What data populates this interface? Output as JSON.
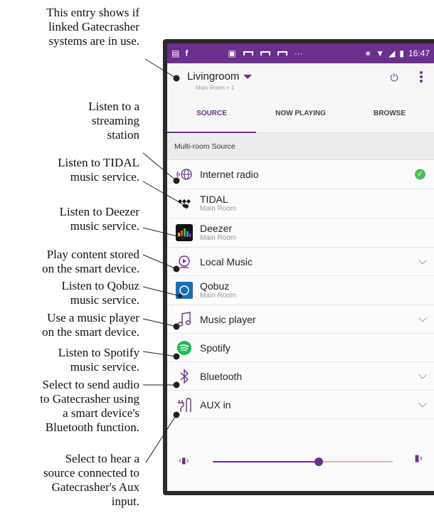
{
  "callouts": {
    "linked": [
      "This entry shows if",
      "linked Gatecrasher",
      "systems are in use."
    ],
    "streaming": [
      "Listen to a",
      "streaming",
      "station"
    ],
    "tidal": [
      "Listen to TIDAL",
      "music service."
    ],
    "deezer": [
      "Listen to Deezer",
      "music service."
    ],
    "local": [
      "Play content stored",
      "on the smart device."
    ],
    "qobuz": [
      "Listen to Qobuz",
      "music service."
    ],
    "player": [
      "Use a music player",
      "on the smart device."
    ],
    "spotify": [
      "Listen to Spotify",
      "music service."
    ],
    "bluetooth": [
      "Select to send audio",
      "to Gatecrasher using",
      "a smart device's",
      "Bluetooth function."
    ],
    "aux": [
      "Select to hear a",
      "source connected to",
      "Gatecrasher's Aux",
      "input."
    ]
  },
  "status_bar": {
    "time": "16:47",
    "dots": "···"
  },
  "header": {
    "room": "Livingroom",
    "room_sub": "Main Room + 1"
  },
  "tabs": [
    {
      "label": "SOURCE",
      "active": true
    },
    {
      "label": "NOW PLAYING",
      "active": false
    },
    {
      "label": "BROWSE",
      "active": false
    }
  ],
  "section_header": "Multi-room Source",
  "sources": [
    {
      "name": "Internet radio",
      "sub": "",
      "icon": "globe-radio-icon",
      "right": "check"
    },
    {
      "name": "TIDAL",
      "sub": "Main Room",
      "icon": "tidal-icon",
      "right": ""
    },
    {
      "name": "Deezer",
      "sub": "Main Room",
      "icon": "deezer-icon",
      "right": ""
    },
    {
      "name": "Local Music",
      "sub": "",
      "icon": "local-music-icon",
      "right": "chevron"
    },
    {
      "name": "Qobuz",
      "sub": "Main Room",
      "icon": "qobuz-icon",
      "right": ""
    },
    {
      "name": "Music player",
      "sub": "",
      "icon": "music-note-icon",
      "right": "chevron"
    },
    {
      "name": "Spotify",
      "sub": "",
      "icon": "spotify-icon",
      "right": ""
    },
    {
      "name": "Bluetooth",
      "sub": "",
      "icon": "bluetooth-icon",
      "right": "chevron"
    },
    {
      "name": "AUX in",
      "sub": "",
      "icon": "aux-plug-icon",
      "right": "chevron"
    }
  ],
  "volume": {
    "level_fraction": 0.59
  },
  "colors": {
    "accent": "#6c2f8c",
    "check": "#4cbf5a"
  }
}
